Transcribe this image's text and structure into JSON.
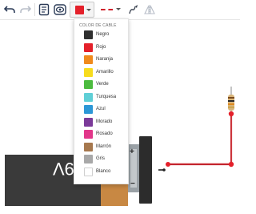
{
  "toolbar": {
    "undo_icon": "undo-icon",
    "redo_icon": "redo-icon",
    "notes_icon": "notes-icon",
    "view_icon": "view-icon",
    "color_value": "#e4202a",
    "line_style_color": "#d0202a",
    "wire_tool_icon": "wire-pen-icon",
    "flip_icon": "flip-icon"
  },
  "dropdown": {
    "title": "COLOR DE CABLE",
    "items": [
      {
        "label": "Negro",
        "color": "#2f2f2f"
      },
      {
        "label": "Rojo",
        "color": "#e4202a"
      },
      {
        "label": "Naranja",
        "color": "#f08a1c"
      },
      {
        "label": "Amarillo",
        "color": "#f7dc1e"
      },
      {
        "label": "Verde",
        "color": "#4cbb3f"
      },
      {
        "label": "Turquesa",
        "color": "#5fcfd6"
      },
      {
        "label": "Azul",
        "color": "#2c97d6"
      },
      {
        "label": "Morado",
        "color": "#7b3a99"
      },
      {
        "label": "Rosado",
        "color": "#e2378a"
      },
      {
        "label": "Marrón",
        "color": "#a6784e"
      },
      {
        "label": "Gris",
        "color": "#a8a8a8"
      },
      {
        "label": "Blanco",
        "color": "#ffffff"
      }
    ]
  },
  "canvas": {
    "battery_label": "9V",
    "plus_sign": "+",
    "minus_sign": "−",
    "wire_color": "#c0202a"
  }
}
